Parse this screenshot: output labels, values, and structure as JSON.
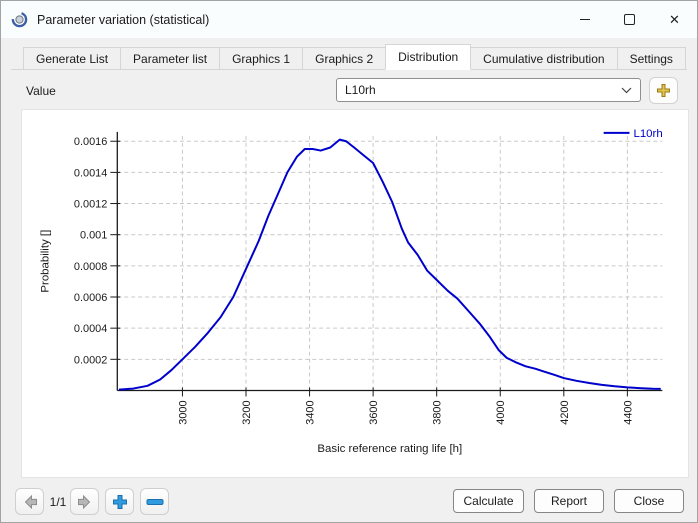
{
  "window": {
    "title": "Parameter variation (statistical)"
  },
  "tabs": {
    "items": [
      {
        "label": "Generate List",
        "active": false
      },
      {
        "label": "Parameter list",
        "active": false
      },
      {
        "label": "Graphics 1",
        "active": false
      },
      {
        "label": "Graphics 2",
        "active": false
      },
      {
        "label": "Distribution",
        "active": true
      },
      {
        "label": "Cumulative distribution",
        "active": false
      },
      {
        "label": "Settings",
        "active": false
      }
    ]
  },
  "value_row": {
    "label": "Value",
    "selected": "L10rh"
  },
  "chart_data": {
    "type": "line",
    "title": "",
    "xlabel": "Basic reference rating life [h]",
    "ylabel": "Probability []",
    "xlim": [
      2795,
      4510
    ],
    "ylim": [
      0,
      0.00166
    ],
    "x_ticks": [
      3000,
      3200,
      3400,
      3600,
      3800,
      4000,
      4200,
      4400
    ],
    "y_ticks": [
      0.0002,
      0.0004,
      0.0006,
      0.0008,
      0.001,
      0.0012,
      0.0014,
      0.0016
    ],
    "grid": true,
    "legend": {
      "position": "top-right",
      "entries": [
        {
          "label": "L10rh",
          "color": "#0000cc"
        }
      ]
    },
    "series": [
      {
        "name": "L10rh",
        "color": "#0000cc",
        "points": [
          [
            2800,
            5e-06
          ],
          [
            2845,
            1.2e-05
          ],
          [
            2890,
            3e-05
          ],
          [
            2930,
            7e-05
          ],
          [
            2965,
            0.00013
          ],
          [
            3000,
            0.0002
          ],
          [
            3040,
            0.00028
          ],
          [
            3080,
            0.00037
          ],
          [
            3120,
            0.00047
          ],
          [
            3160,
            0.0006
          ],
          [
            3200,
            0.00078
          ],
          [
            3240,
            0.00096
          ],
          [
            3270,
            0.00112
          ],
          [
            3300,
            0.00126
          ],
          [
            3330,
            0.0014
          ],
          [
            3360,
            0.0015
          ],
          [
            3385,
            0.00155
          ],
          [
            3410,
            0.00155
          ],
          [
            3435,
            0.00154
          ],
          [
            3465,
            0.00156
          ],
          [
            3495,
            0.00161
          ],
          [
            3515,
            0.0016
          ],
          [
            3540,
            0.00156
          ],
          [
            3570,
            0.00151
          ],
          [
            3600,
            0.00146
          ],
          [
            3630,
            0.00134
          ],
          [
            3660,
            0.00121
          ],
          [
            3690,
            0.00104
          ],
          [
            3710,
            0.00095
          ],
          [
            3740,
            0.00087
          ],
          [
            3770,
            0.00077
          ],
          [
            3800,
            0.00071
          ],
          [
            3835,
            0.00064
          ],
          [
            3865,
            0.00059
          ],
          [
            3900,
            0.00051
          ],
          [
            3935,
            0.00043
          ],
          [
            3965,
            0.00035
          ],
          [
            3995,
            0.00026
          ],
          [
            4020,
            0.00021
          ],
          [
            4050,
            0.00018
          ],
          [
            4080,
            0.000155
          ],
          [
            4110,
            0.00014
          ],
          [
            4140,
            0.00012
          ],
          [
            4170,
            0.0001
          ],
          [
            4200,
            8e-05
          ],
          [
            4240,
            6.2e-05
          ],
          [
            4280,
            4.8e-05
          ],
          [
            4320,
            3.6e-05
          ],
          [
            4360,
            2.7e-05
          ],
          [
            4400,
            2e-05
          ],
          [
            4445,
            1.4e-05
          ],
          [
            4480,
            1.1e-05
          ],
          [
            4505,
            1e-05
          ]
        ]
      }
    ]
  },
  "pager": {
    "page_indicator": "1/1"
  },
  "footer": {
    "buttons": [
      "Calculate",
      "Report",
      "Close"
    ]
  },
  "colors": {
    "curve": "#0000cc",
    "grid": "#c9c9c9",
    "gold_plus": "#e3c44a",
    "toolbar_blue": "#2f9ce0"
  }
}
